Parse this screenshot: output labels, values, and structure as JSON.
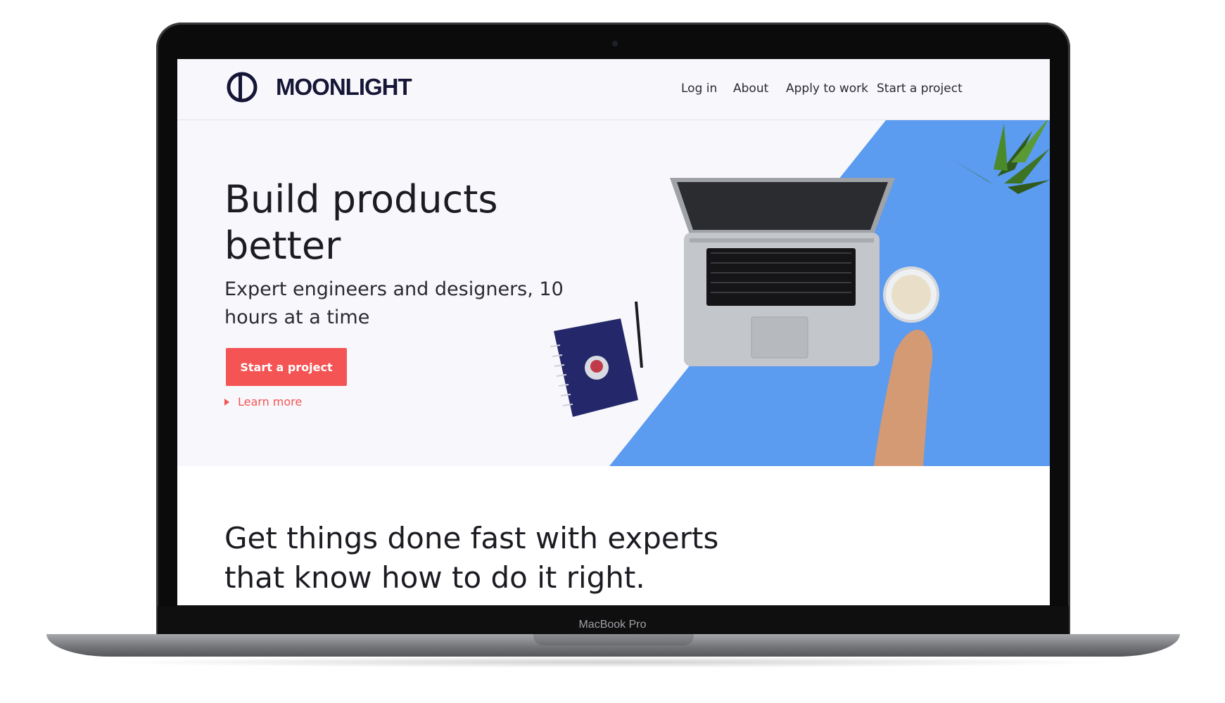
{
  "device": {
    "label": "MacBook Pro"
  },
  "brand": {
    "name": "MOONLIGHT"
  },
  "nav": {
    "items": [
      "Log in",
      "About",
      "Apply to work",
      "Start a project"
    ]
  },
  "hero": {
    "title": "Build products better",
    "subtitle": "Expert engineers and designers, 10 hours at a time",
    "cta_label": "Start a project",
    "link_label": "Learn more"
  },
  "section2": {
    "title": "Get things done fast with experts that know how to do it right."
  },
  "colors": {
    "accent": "#f45454",
    "brand": "#151536",
    "hero_background": "#f8f7fc",
    "blue_panel": "#5b9bf0"
  }
}
